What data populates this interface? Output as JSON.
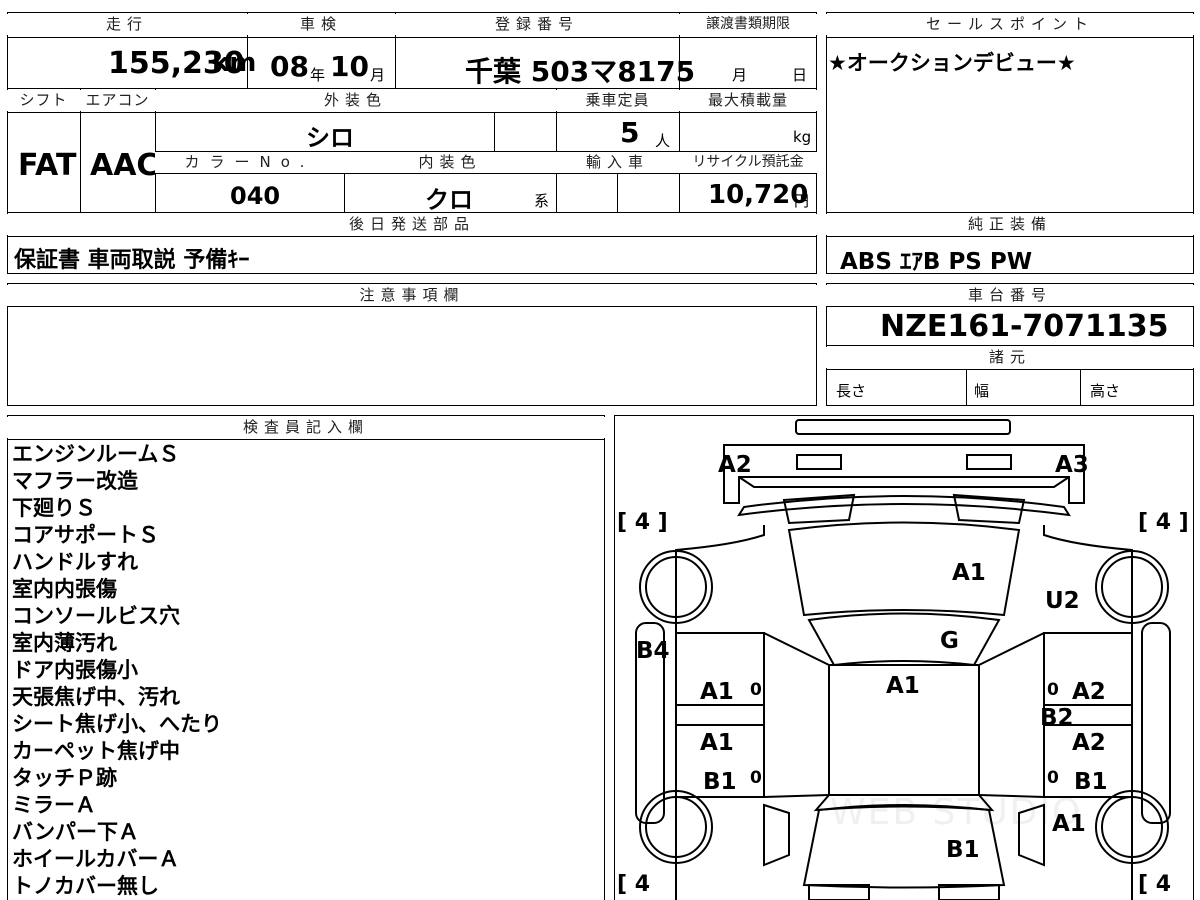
{
  "top": {
    "mileage_label": "走行",
    "mileage_value": "155,230",
    "mileage_unit": "km",
    "shaken_label": "車検",
    "shaken_year": "08",
    "shaken_year_unit": "年",
    "shaken_month": "10",
    "shaken_month_unit": "月",
    "reg_label": "登録番号",
    "reg_value": "千葉 503マ8175",
    "transfer_label": "譲渡書類期限",
    "transfer_month_unit": "月",
    "transfer_day_unit": "日"
  },
  "row2": {
    "shift_label": "シフト",
    "ac_label": "エアコン",
    "exterior_label": "外装色",
    "capacity_label": "乗車定員",
    "maxload_label": "最大積載量",
    "shift_value": "FAT",
    "ac_value": "AAC",
    "exterior_value": "シロ",
    "capacity_value": "5",
    "capacity_unit": "人",
    "maxload_unit": "kg",
    "color_no_label": "カラーNo.",
    "interior_label": "内装色",
    "import_label": "輸入車",
    "recycle_label": "リサイクル預託金",
    "color_no_value": "040",
    "interior_value": "クロ",
    "interior_suffix": "系",
    "recycle_value": "10,720",
    "recycle_unit": "円"
  },
  "later_parts": {
    "label": "後日発送部品",
    "value": "保証書 車両取説 予備ｷｰ"
  },
  "sales": {
    "label": "セールスポイント",
    "value": "★オークションデビュー★"
  },
  "equipment": {
    "label": "純正装備",
    "value": "ABS ｴｱB PS PW"
  },
  "caution": {
    "label": "注意事項欄"
  },
  "chassis": {
    "label": "車台番号",
    "value": "NZE161-7071135",
    "spec_label": "諸元",
    "length_label": "長さ",
    "width_label": "幅",
    "height_label": "高さ"
  },
  "inspector": {
    "label": "検査員記入欄",
    "notes": [
      "エンジンルームＳ",
      "マフラー改造",
      "下廻りＳ",
      "コアサポートＳ",
      "ハンドルすれ",
      "室内内張傷",
      "コンソールビス穴",
      "室内薄汚れ",
      "ドア内張傷小",
      "天張焦げ中、汚れ",
      "シート焦げ小、へたり",
      "カーペット焦げ中",
      "タッチＰ跡",
      "ミラーＡ",
      "バンパー下Ａ",
      "ホイールカバーＡ",
      "トノカバー無し"
    ]
  },
  "diagram": {
    "tire_fl": "[ 4 ]",
    "tire_fr": "[ 4 ]",
    "tire_rl": "[ 4",
    "tire_rr": "[ 4",
    "labels": {
      "a2_front_left": "A2",
      "a3_front_right": "A3",
      "a1_hood": "A1",
      "u2_fender": "U2",
      "g_windshield": "G",
      "b4_side": "B4",
      "a1_roof": "A1",
      "a1_front_door_left": "A1",
      "a2_front_door_right": "A2",
      "b2_pillar": "B2",
      "a1_rear_door_left": "A1",
      "a2_rear_door_right": "A2",
      "b1_rear_left": "B1",
      "b1_rear_right": "B1",
      "a1_rear_fender": "A1",
      "b1_trunk": "B1",
      "zero1": "0",
      "zero2": "0",
      "zero3": "0",
      "zero4": "0"
    },
    "watermark": "WEB STUDIO"
  }
}
